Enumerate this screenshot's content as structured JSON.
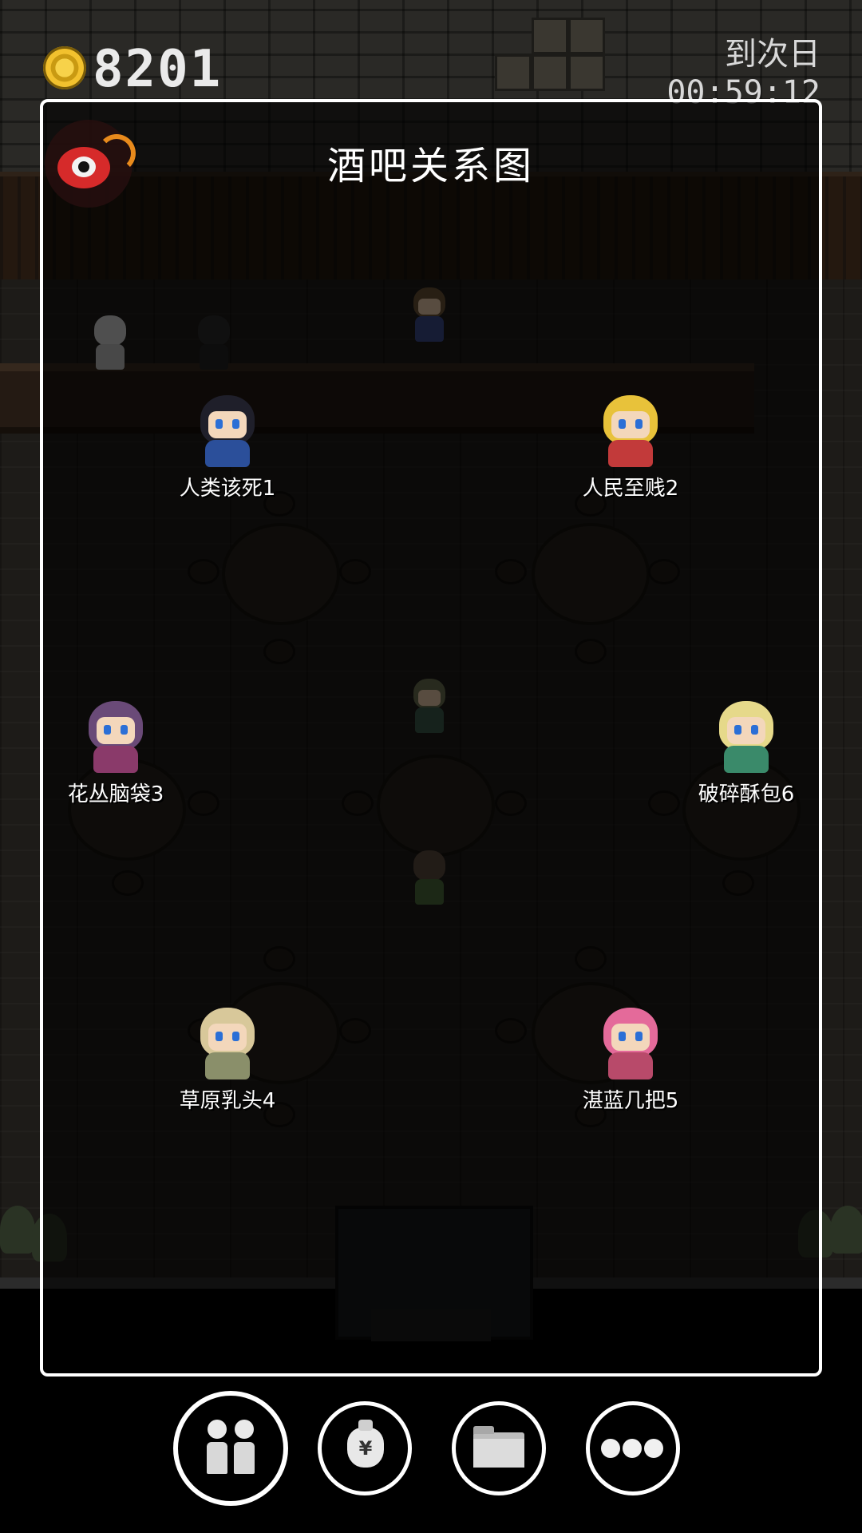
{
  "hud": {
    "gold": "8201",
    "next_day_label": "到次日",
    "countdown": "00:59:12"
  },
  "panel": {
    "title": "酒吧关系图",
    "weibo_icon": "weibo-icon"
  },
  "members": [
    {
      "name": "人类该死1",
      "hair": "#1f1f2a",
      "body": "#2b4f9a",
      "hat": "#bfbfbf"
    },
    {
      "name": "人民至贱2",
      "hair": "#e8c23a",
      "body": "#c23a3a",
      "hat": "#c0332b"
    },
    {
      "name": "花丛脑袋3",
      "hair": "#6a4a78",
      "body": "#8a3a6a",
      "hat": "#7a3e9a"
    },
    {
      "name": "破碎酥包6",
      "hair": "#e6d98a",
      "body": "#3a8a6a",
      "hat": "#e6d98a"
    },
    {
      "name": "草原乳头4",
      "hair": "#d8c89a",
      "body": "#8a8f6a",
      "hat": "#ece2c0"
    },
    {
      "name": "湛蓝几把5",
      "hair": "#e46a9a",
      "body": "#b84a6a",
      "hat": "#e46a9a"
    }
  ],
  "toolbar": [
    {
      "icon": "people-icon",
      "name": "relationship-button"
    },
    {
      "icon": "money-bag-icon",
      "name": "money-button"
    },
    {
      "icon": "folder-icon",
      "name": "folder-button"
    },
    {
      "icon": "more-icon",
      "name": "more-button"
    }
  ],
  "colors": {
    "panel_border": "#ffffff",
    "coin": "#f2c12e",
    "background": "#000000"
  }
}
